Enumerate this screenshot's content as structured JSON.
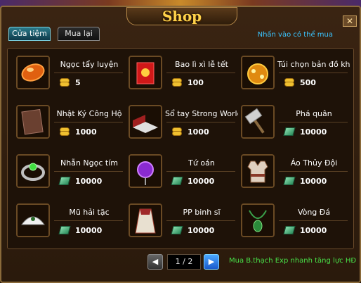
{
  "window": {
    "title": "Shop",
    "close_label": "✕"
  },
  "tabs": [
    {
      "label": "Cửa tiệm"
    },
    {
      "label": "Mua lại"
    }
  ],
  "hint": "Nhấn vào có thể mua",
  "items": [
    {
      "name": "Ngọc tẩy luyện",
      "price": "5",
      "currency": "gold-coin-icon",
      "icon": "orange-gem-icon"
    },
    {
      "name": "Bao lì xì lễ tết",
      "price": "100",
      "currency": "gold-coin-icon",
      "icon": "red-envelope-icon"
    },
    {
      "name": "Túi chọn bản đồ kho báu",
      "price": "500",
      "currency": "gold-coin-icon",
      "icon": "treasure-bag-icon"
    },
    {
      "name": "Nhật Ký Công Hộ",
      "price": "1000",
      "currency": "gold-coin-icon",
      "icon": "diary-icon"
    },
    {
      "name": "Sổ tay Strong World",
      "price": "1000",
      "currency": "gold-coin-icon",
      "icon": "open-book-icon"
    },
    {
      "name": "Phá quân",
      "price": "10000",
      "currency": "green-gem-icon",
      "icon": "hammer-icon"
    },
    {
      "name": "Nhẫn Ngọc tím",
      "price": "10000",
      "currency": "green-gem-icon",
      "icon": "ring-icon"
    },
    {
      "name": "Tứ oán",
      "price": "10000",
      "currency": "green-gem-icon",
      "icon": "purple-orb-icon"
    },
    {
      "name": "Áo Thủy Đội",
      "price": "10000",
      "currency": "green-gem-icon",
      "icon": "vest-icon"
    },
    {
      "name": "Mũ hải tặc",
      "price": "10000",
      "currency": "green-gem-icon",
      "icon": "pirate-hat-icon"
    },
    {
      "name": "PP binh sĩ",
      "price": "10000",
      "currency": "green-gem-icon",
      "icon": "cape-icon"
    },
    {
      "name": "Vòng Đá",
      "price": "10000",
      "currency": "green-gem-icon",
      "icon": "necklace-icon"
    }
  ],
  "pager": {
    "text": "1 / 2",
    "prev": "◀",
    "next": "▶"
  },
  "promo": "Mua B.thạch Exp nhanh tăng lực HĐ",
  "colors": {
    "accent": "#ffd24a",
    "hint": "#3ac4ff",
    "promo": "#48e048"
  }
}
